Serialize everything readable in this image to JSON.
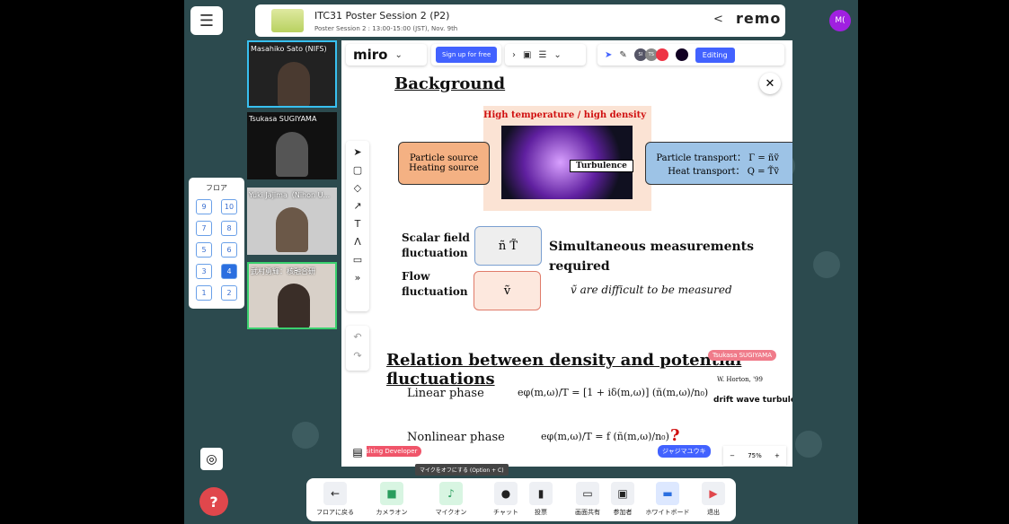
{
  "header": {
    "title": "ITC31 Poster Session 2 (P2)",
    "subtitle": "Poster Session 2 : 13:00-15:00 (JST), Nov. 9th",
    "brand": "remo",
    "user_initials": "M("
  },
  "videos": [
    {
      "name": "Masahiko Sato (NIFS)"
    },
    {
      "name": "Tsukasa SUGIYAMA"
    },
    {
      "name": "Yuki Jajima（Nihon U..."
    },
    {
      "name": "武村勇輝：核融合研"
    }
  ],
  "floor": {
    "label": "フロア",
    "buttons": [
      "9",
      "10",
      "7",
      "8",
      "5",
      "6",
      "3",
      "4",
      "1",
      "2"
    ],
    "selected": "4"
  },
  "miro": {
    "logo": "miro",
    "signup": "Sign up for free",
    "editing": "Editing",
    "collaborators": [
      "SI",
      "TS"
    ],
    "zoom": "75%"
  },
  "poster": {
    "background_title": "Background",
    "high_temp": "High temperature / high density",
    "sources": [
      "Particle source",
      "Heating source"
    ],
    "turbulence": "Turbulence",
    "transport": [
      "Particle transport： Γ = ñṽ",
      "Heat transport： Q = T̃ṽ"
    ],
    "scalar_label": [
      "Scalar field",
      "fluctuation"
    ],
    "scalar_vars": "ñ    T̃",
    "flow_label": [
      "Flow",
      "fluctuation"
    ],
    "flow_var": "ṽ",
    "simultaneous": [
      "Simultaneous measurements",
      "required"
    ],
    "difficult": "ṽ are difficult to be measured",
    "relation_title": "Relation between  density and potential fluctuations",
    "linear": "Linear phase",
    "linear_eq": "eφ(m,ω)/T = [1 + iδ(m,ω)] (ñ(m,ω)/n₀)",
    "horton": "W. Horton, '99",
    "drift": "drift wave turbule",
    "nonlinear": "Nonlinear phase",
    "nonlinear_eq": "eφ(m,ω)/T = f (ñ(m,ω)/n₀)",
    "question": "?"
  },
  "cursors": [
    {
      "name": "Tsukasa SUGIYAMA",
      "color": "#f07b8a"
    },
    {
      "name": "siting Developer",
      "color": "#f0556a"
    },
    {
      "name": "ジャジマユウキ",
      "color": "#4262ff"
    }
  ],
  "tooltip": "マイクをオフにする (Option + C)",
  "bottom": [
    "フロアに戻る",
    "カメラオン",
    "マイクオン",
    "チャット",
    "投票",
    "画面共有",
    "参加者",
    "ホワイトボード",
    "退出"
  ]
}
